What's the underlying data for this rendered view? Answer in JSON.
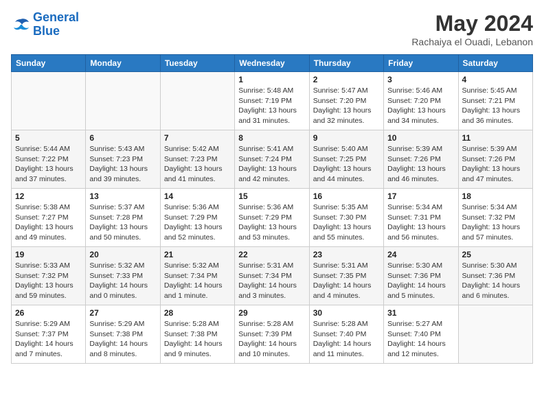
{
  "header": {
    "logo_general": "General",
    "logo_blue": "Blue",
    "month": "May 2024",
    "location": "Rachaiya el Ouadi, Lebanon"
  },
  "weekdays": [
    "Sunday",
    "Monday",
    "Tuesday",
    "Wednesday",
    "Thursday",
    "Friday",
    "Saturday"
  ],
  "weeks": [
    [
      {
        "day": "",
        "info": ""
      },
      {
        "day": "",
        "info": ""
      },
      {
        "day": "",
        "info": ""
      },
      {
        "day": "1",
        "info": "Sunrise: 5:48 AM\nSunset: 7:19 PM\nDaylight: 13 hours\nand 31 minutes."
      },
      {
        "day": "2",
        "info": "Sunrise: 5:47 AM\nSunset: 7:20 PM\nDaylight: 13 hours\nand 32 minutes."
      },
      {
        "day": "3",
        "info": "Sunrise: 5:46 AM\nSunset: 7:20 PM\nDaylight: 13 hours\nand 34 minutes."
      },
      {
        "day": "4",
        "info": "Sunrise: 5:45 AM\nSunset: 7:21 PM\nDaylight: 13 hours\nand 36 minutes."
      }
    ],
    [
      {
        "day": "5",
        "info": "Sunrise: 5:44 AM\nSunset: 7:22 PM\nDaylight: 13 hours\nand 37 minutes."
      },
      {
        "day": "6",
        "info": "Sunrise: 5:43 AM\nSunset: 7:23 PM\nDaylight: 13 hours\nand 39 minutes."
      },
      {
        "day": "7",
        "info": "Sunrise: 5:42 AM\nSunset: 7:23 PM\nDaylight: 13 hours\nand 41 minutes."
      },
      {
        "day": "8",
        "info": "Sunrise: 5:41 AM\nSunset: 7:24 PM\nDaylight: 13 hours\nand 42 minutes."
      },
      {
        "day": "9",
        "info": "Sunrise: 5:40 AM\nSunset: 7:25 PM\nDaylight: 13 hours\nand 44 minutes."
      },
      {
        "day": "10",
        "info": "Sunrise: 5:39 AM\nSunset: 7:26 PM\nDaylight: 13 hours\nand 46 minutes."
      },
      {
        "day": "11",
        "info": "Sunrise: 5:39 AM\nSunset: 7:26 PM\nDaylight: 13 hours\nand 47 minutes."
      }
    ],
    [
      {
        "day": "12",
        "info": "Sunrise: 5:38 AM\nSunset: 7:27 PM\nDaylight: 13 hours\nand 49 minutes."
      },
      {
        "day": "13",
        "info": "Sunrise: 5:37 AM\nSunset: 7:28 PM\nDaylight: 13 hours\nand 50 minutes."
      },
      {
        "day": "14",
        "info": "Sunrise: 5:36 AM\nSunset: 7:29 PM\nDaylight: 13 hours\nand 52 minutes."
      },
      {
        "day": "15",
        "info": "Sunrise: 5:36 AM\nSunset: 7:29 PM\nDaylight: 13 hours\nand 53 minutes."
      },
      {
        "day": "16",
        "info": "Sunrise: 5:35 AM\nSunset: 7:30 PM\nDaylight: 13 hours\nand 55 minutes."
      },
      {
        "day": "17",
        "info": "Sunrise: 5:34 AM\nSunset: 7:31 PM\nDaylight: 13 hours\nand 56 minutes."
      },
      {
        "day": "18",
        "info": "Sunrise: 5:34 AM\nSunset: 7:32 PM\nDaylight: 13 hours\nand 57 minutes."
      }
    ],
    [
      {
        "day": "19",
        "info": "Sunrise: 5:33 AM\nSunset: 7:32 PM\nDaylight: 13 hours\nand 59 minutes."
      },
      {
        "day": "20",
        "info": "Sunrise: 5:32 AM\nSunset: 7:33 PM\nDaylight: 14 hours\nand 0 minutes."
      },
      {
        "day": "21",
        "info": "Sunrise: 5:32 AM\nSunset: 7:34 PM\nDaylight: 14 hours\nand 1 minute."
      },
      {
        "day": "22",
        "info": "Sunrise: 5:31 AM\nSunset: 7:34 PM\nDaylight: 14 hours\nand 3 minutes."
      },
      {
        "day": "23",
        "info": "Sunrise: 5:31 AM\nSunset: 7:35 PM\nDaylight: 14 hours\nand 4 minutes."
      },
      {
        "day": "24",
        "info": "Sunrise: 5:30 AM\nSunset: 7:36 PM\nDaylight: 14 hours\nand 5 minutes."
      },
      {
        "day": "25",
        "info": "Sunrise: 5:30 AM\nSunset: 7:36 PM\nDaylight: 14 hours\nand 6 minutes."
      }
    ],
    [
      {
        "day": "26",
        "info": "Sunrise: 5:29 AM\nSunset: 7:37 PM\nDaylight: 14 hours\nand 7 minutes."
      },
      {
        "day": "27",
        "info": "Sunrise: 5:29 AM\nSunset: 7:38 PM\nDaylight: 14 hours\nand 8 minutes."
      },
      {
        "day": "28",
        "info": "Sunrise: 5:28 AM\nSunset: 7:38 PM\nDaylight: 14 hours\nand 9 minutes."
      },
      {
        "day": "29",
        "info": "Sunrise: 5:28 AM\nSunset: 7:39 PM\nDaylight: 14 hours\nand 10 minutes."
      },
      {
        "day": "30",
        "info": "Sunrise: 5:28 AM\nSunset: 7:40 PM\nDaylight: 14 hours\nand 11 minutes."
      },
      {
        "day": "31",
        "info": "Sunrise: 5:27 AM\nSunset: 7:40 PM\nDaylight: 14 hours\nand 12 minutes."
      },
      {
        "day": "",
        "info": ""
      }
    ]
  ]
}
